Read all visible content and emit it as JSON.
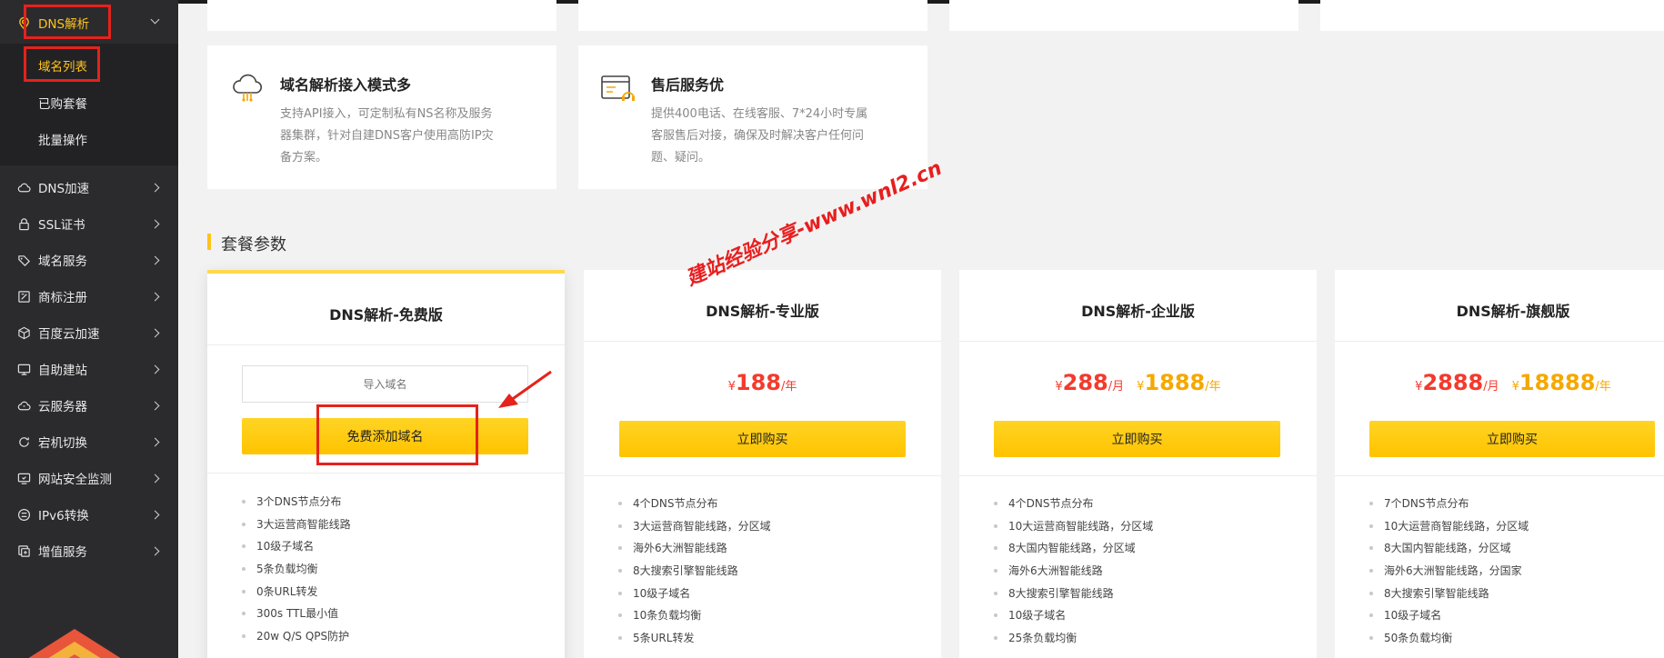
{
  "sidebar": {
    "dns": {
      "label": "DNS解析"
    },
    "sub_items": [
      {
        "label": "域名列表"
      },
      {
        "label": "已购套餐"
      },
      {
        "label": "批量操作"
      }
    ],
    "items": [
      {
        "label": "DNS加速",
        "icon": "cloud-icon"
      },
      {
        "label": "SSL证书",
        "icon": "lock-icon"
      },
      {
        "label": "域名服务",
        "icon": "tag-icon"
      },
      {
        "label": "商标注册",
        "icon": "trademark-icon"
      },
      {
        "label": "百度云加速",
        "icon": "cube-icon"
      },
      {
        "label": "自助建站",
        "icon": "monitor-icon"
      },
      {
        "label": "云服务器",
        "icon": "cloud-server-icon"
      },
      {
        "label": "宕机切换",
        "icon": "switch-icon"
      },
      {
        "label": "网站安全监测",
        "icon": "shield-monitor-icon"
      },
      {
        "label": "IPv6转换",
        "icon": "ipv6-icon"
      },
      {
        "label": "增值服务",
        "icon": "plus-service-icon"
      }
    ]
  },
  "features": [
    {
      "title": "域名解析接入模式多",
      "desc": [
        "支持API接入，可定制私有NS名称及服务",
        "器集群，针对自建DNS客户使用高防IP灾",
        "备方案。"
      ],
      "icon": "cloud-connect-icon"
    },
    {
      "title": "售后服务优",
      "desc": [
        "提供400电话、在线客服、7*24小时专属",
        "客服售后对接，确保及时解决客户任何问",
        "题、疑问。"
      ],
      "icon": "service-headset-icon"
    }
  ],
  "section_title": "套餐参数",
  "plans": [
    {
      "name": "DNS解析-免费版",
      "input_placeholder": "导入域名",
      "button": "免费添加域名",
      "features": [
        "3个DNS节点分布",
        "3大运营商智能线路",
        "10级子域名",
        "5条负载均衡",
        "0条URL转发",
        "300s TTL最小值",
        "20w Q/S QPS防护"
      ]
    },
    {
      "name": "DNS解析-专业版",
      "price": {
        "currency": "¥",
        "amount": "188",
        "unit": "/年"
      },
      "button": "立即购买",
      "features": [
        "4个DNS节点分布",
        "3大运营商智能线路，分区域",
        "海外6大洲智能线路",
        "8大搜索引擎智能线路",
        "10级子域名",
        "10条负载均衡",
        "5条URL转发"
      ]
    },
    {
      "name": "DNS解析-企业版",
      "price_month": {
        "currency": "¥",
        "amount": "288",
        "unit": "/月"
      },
      "price_year": {
        "currency": "¥",
        "amount": "1888",
        "unit": "/年"
      },
      "button": "立即购买",
      "features": [
        "4个DNS节点分布",
        "10大运营商智能线路，分区域",
        "8大国内智能线路，分区域",
        "海外6大洲智能线路",
        "8大搜索引擎智能线路",
        "10级子域名",
        "25条负载均衡"
      ]
    },
    {
      "name": "DNS解析-旗舰版",
      "price_month": {
        "currency": "¥",
        "amount": "2888",
        "unit": "/月"
      },
      "price_year": {
        "currency": "¥",
        "amount": "18888",
        "unit": "/年"
      },
      "button": "立即购买",
      "features": [
        "7个DNS节点分布",
        "10大运营商智能线路，分区域",
        "8大国内智能线路，分区域",
        "海外6大洲智能线路，分国家",
        "8大搜索引擎智能线路",
        "10级子域名",
        "50条负载均衡"
      ]
    }
  ],
  "watermark": "建站经验分享-www.wnl2.cn",
  "colors": {
    "accent": "#ffc21a",
    "price_red": "#f43a2d",
    "price_gold": "#f5a800",
    "annotation_red": "#e5221c",
    "sidebar_bg": "#2b2b2e"
  }
}
